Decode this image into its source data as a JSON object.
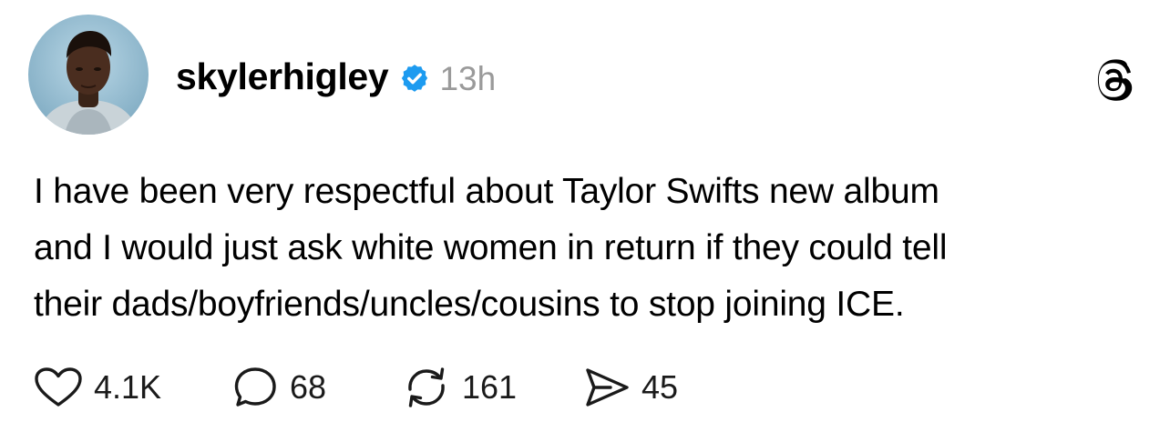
{
  "post": {
    "author": {
      "username": "skylerhigley",
      "verified": true,
      "avatar_icon": "profile-photo",
      "verified_icon": "verified-badge-icon",
      "verified_color": "#1d9bf0"
    },
    "timestamp": "13h",
    "platform_icon": "threads-logo-icon",
    "text_lines": [
      "I have been very respectful about Taylor Swifts new album",
      "and I would just ask white women in return if they could tell",
      "their dads/boyfriends/uncles/cousins to stop joining ICE."
    ],
    "actions": {
      "likes": "4.1K",
      "replies": "68",
      "reposts": "161",
      "shares": "45"
    }
  }
}
